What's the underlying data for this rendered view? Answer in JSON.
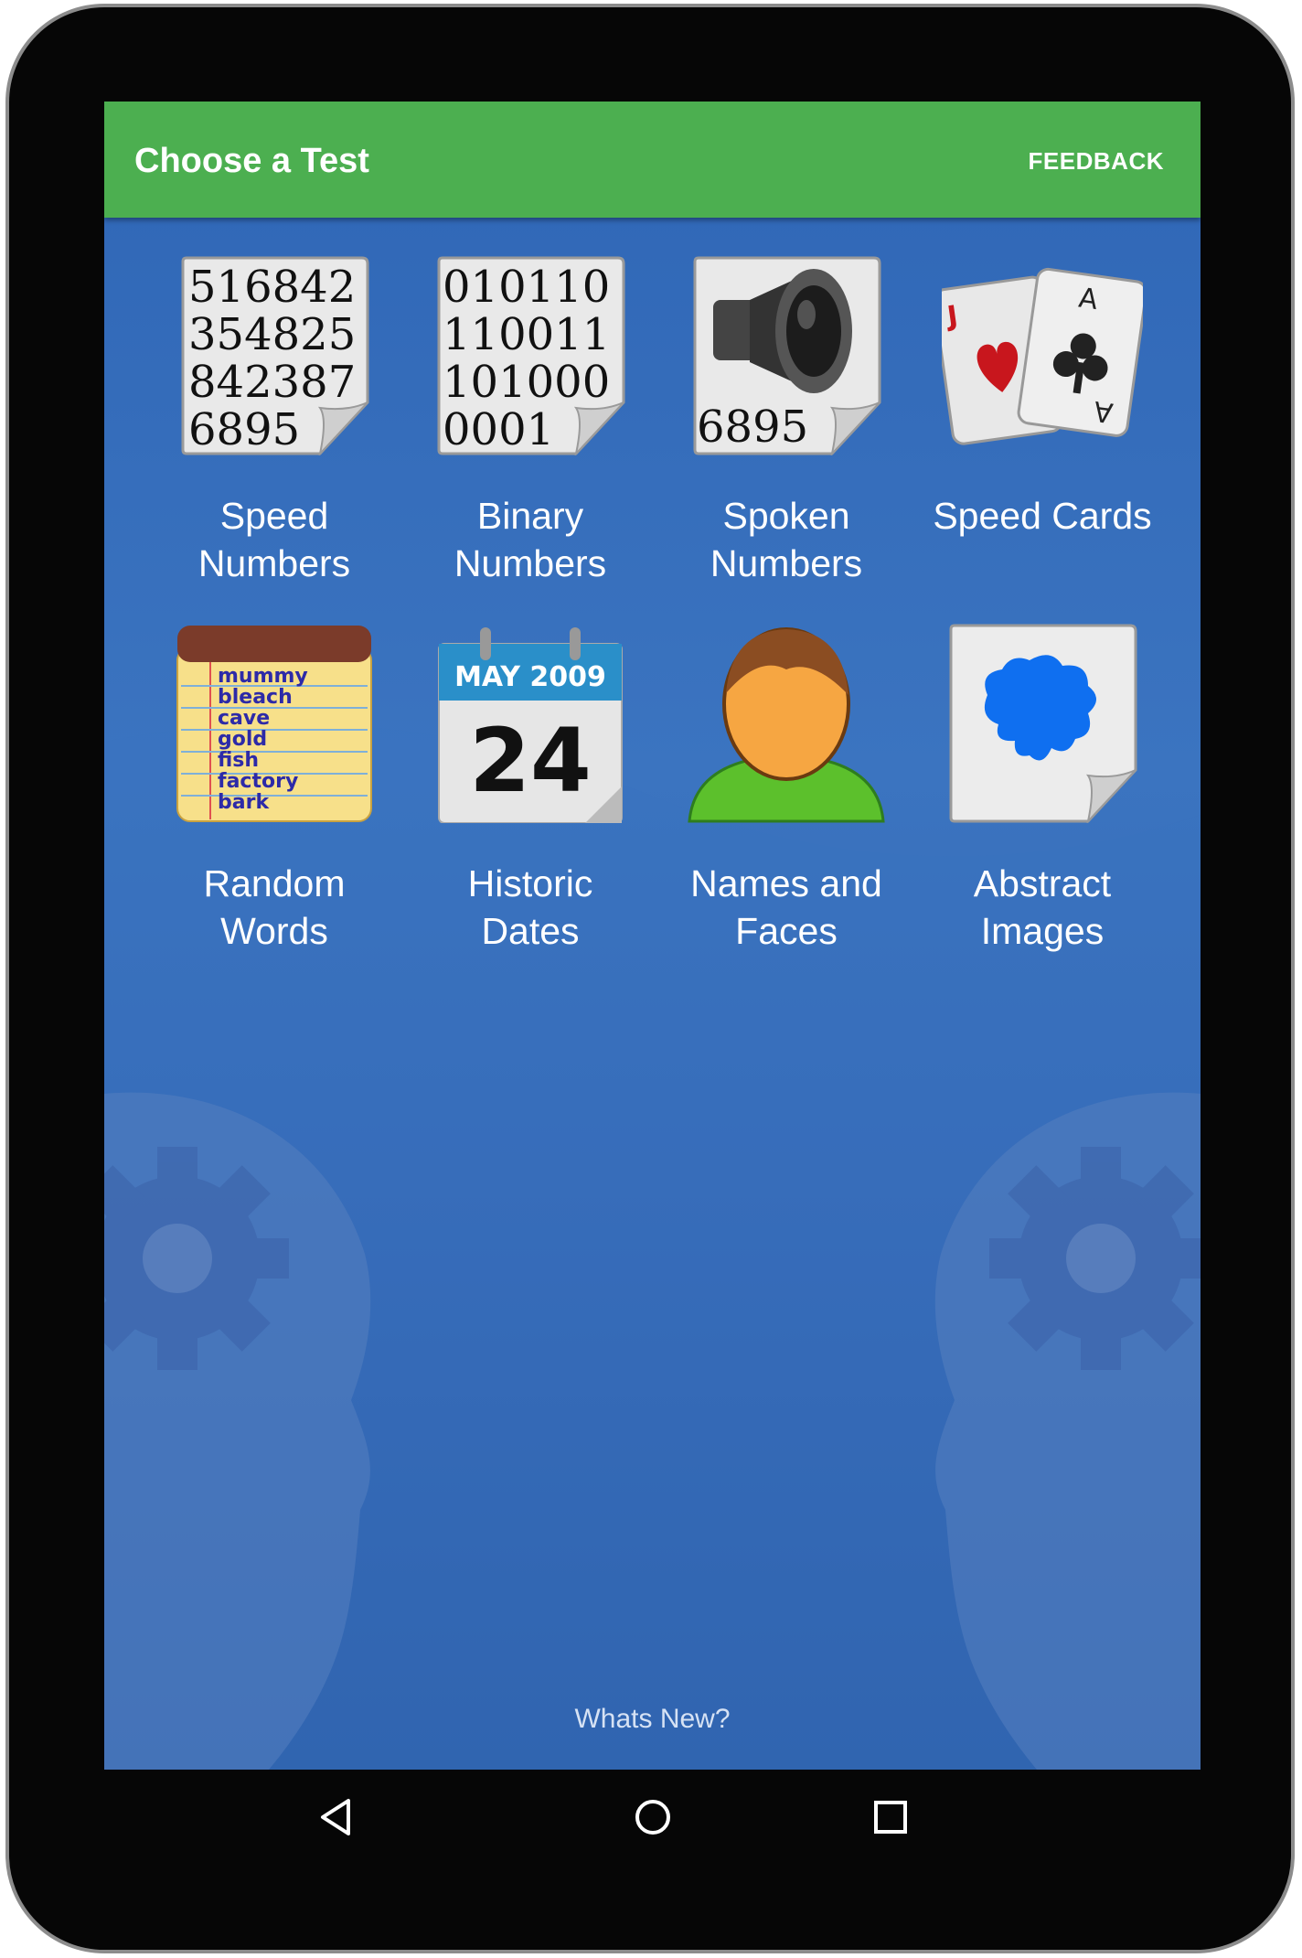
{
  "app_bar": {
    "title": "Choose a Test",
    "feedback_label": "FEEDBACK"
  },
  "tests": [
    {
      "line1": "Speed",
      "line2": "Numbers",
      "icon": "digits-page-icon",
      "digits": [
        "516842",
        "354825",
        "842387",
        "6895"
      ]
    },
    {
      "line1": "Binary",
      "line2": "Numbers",
      "icon": "binary-page-icon",
      "digits": [
        "010110",
        "110011",
        "101000",
        "0001"
      ]
    },
    {
      "line1": "Spoken",
      "line2": "Numbers",
      "icon": "speaker-page-icon",
      "digits": [
        "6895"
      ]
    },
    {
      "line1": "Speed Cards",
      "line2": "",
      "icon": "playing-cards-icon",
      "cards": [
        "J",
        "A"
      ]
    },
    {
      "line1": "Random",
      "line2": "Words",
      "icon": "notepad-words-icon",
      "words": [
        "mummy",
        "bleach",
        "cave",
        "gold",
        "fish",
        "factory",
        "bark"
      ]
    },
    {
      "line1": "Historic",
      "line2": "Dates",
      "icon": "calendar-icon",
      "month": "MAY 2009",
      "day": "24"
    },
    {
      "line1": "Names and",
      "line2": "Faces",
      "icon": "person-icon"
    },
    {
      "line1": "Abstract",
      "line2": "Images",
      "icon": "abstract-blob-icon"
    }
  ],
  "footer": {
    "whats_new": "Whats New?"
  },
  "nav": {
    "back": "back-icon",
    "home": "home-icon",
    "recents": "recents-icon"
  },
  "colors": {
    "app_bar": "#4caf50",
    "background": "#3568b5",
    "text": "#ffffff"
  }
}
